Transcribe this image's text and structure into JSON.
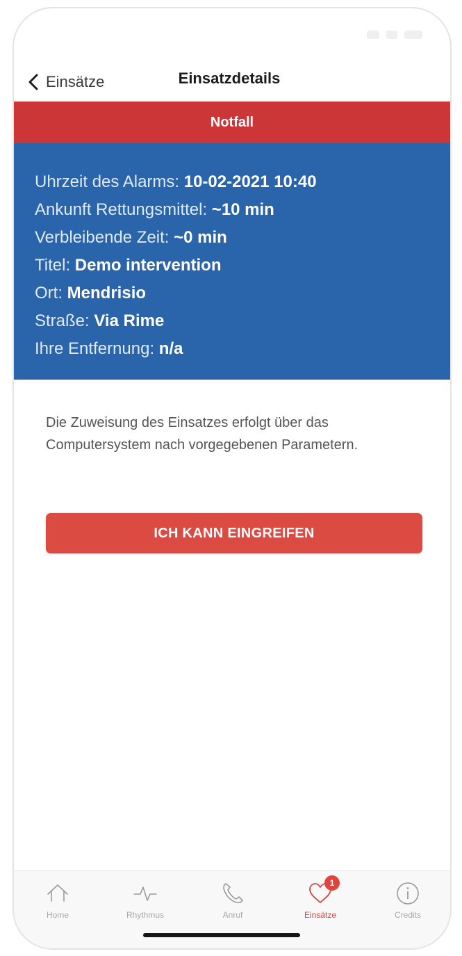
{
  "nav": {
    "back_label": "Einsätze",
    "title": "Einsatzdetails"
  },
  "banner": {
    "label": "Notfall"
  },
  "info": [
    {
      "label": "Uhrzeit des Alarms: ",
      "value": "10-02-2021 10:40"
    },
    {
      "label": "Ankunft Rettungsmittel: ",
      "value": "~10 min"
    },
    {
      "label": "Verbleibende Zeit: ",
      "value": "~0 min"
    },
    {
      "label": "Titel: ",
      "value": "Demo intervention"
    },
    {
      "label": "Ort: ",
      "value": "Mendrisio"
    },
    {
      "label": "Straße: ",
      "value": "Via Rime"
    },
    {
      "label": "Ihre Entfernung: ",
      "value": "n/a"
    }
  ],
  "description": "Die Zuweisung des Einsatzes erfolgt über das Computersystem nach vorgegebenen Parametern.",
  "cta_label": "ICH KANN EINGREIFEN",
  "tabs": [
    {
      "label": "Home",
      "icon": "home-icon"
    },
    {
      "label": "Rhythmus",
      "icon": "pulse-icon"
    },
    {
      "label": "Anruf",
      "icon": "phone-icon"
    },
    {
      "label": "Einsätze",
      "icon": "heart-icon",
      "badge": "1",
      "active": true
    },
    {
      "label": "Credits",
      "icon": "info-icon"
    }
  ],
  "colors": {
    "banner_red": "#cc3636",
    "info_blue": "#2a65ab",
    "cta_red": "#dc4b42",
    "active_tab": "#d9443c"
  }
}
